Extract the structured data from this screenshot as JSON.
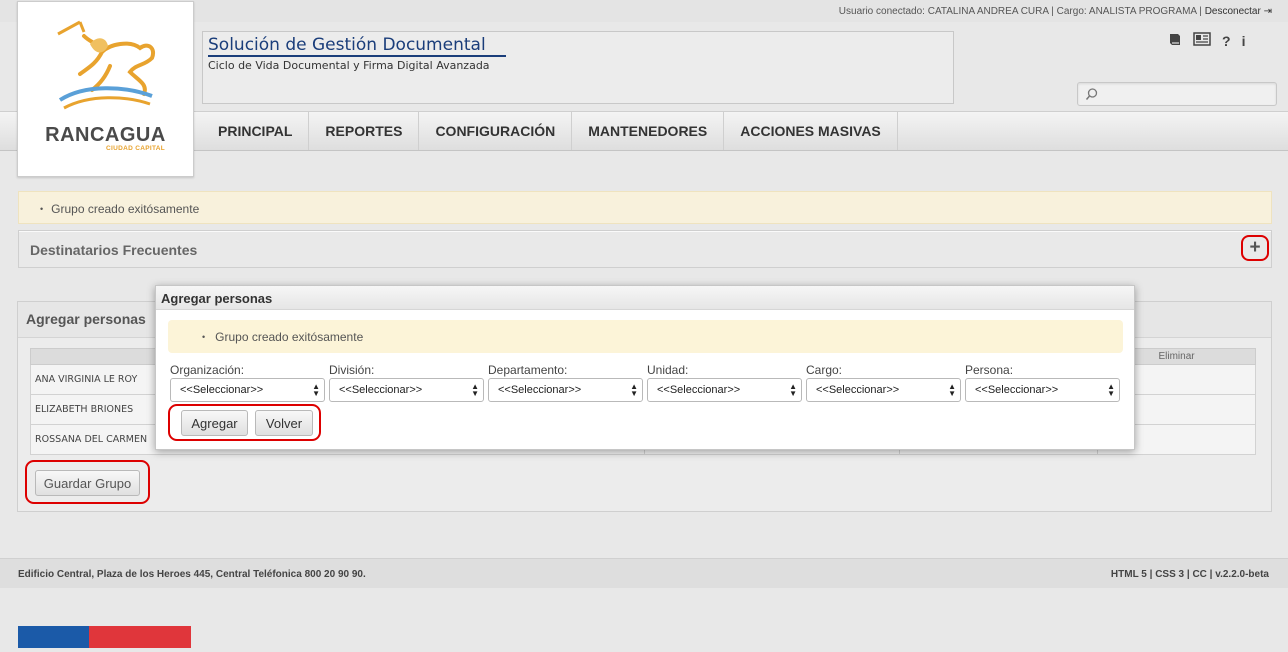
{
  "session": {
    "user_info": "Usuario conectado: CATALINA ANDREA CURA | Cargo: ANALISTA PROGRAMA |",
    "logout": "Desconectar"
  },
  "logo": {
    "city": "RANCAGUA",
    "subtitle": "CIUDAD CAPITAL"
  },
  "app": {
    "title": "Solución de Gestión Documental",
    "subtitle": "Ciclo de Vida Documental y Firma Digital Avanzada"
  },
  "header_icons": [
    "book-icon",
    "news-icon",
    "help-icon",
    "info-icon"
  ],
  "search": {
    "placeholder": ""
  },
  "nav": {
    "items": [
      "PRINCIPAL",
      "REPORTES",
      "CONFIGURACIÓN",
      "MANTENEDORES",
      "ACCIONES MASIVAS"
    ]
  },
  "alert": {
    "message": "Grupo creado exitósamente"
  },
  "destinatarios": {
    "title": "Destinatarios Frecuentes",
    "add_symbol": "+"
  },
  "panel": {
    "title": "Agregar personas",
    "table": {
      "header_last": "Eliminar",
      "rows": [
        "ANA VIRGINIA LE ROY",
        "ELIZABETH BRIONES",
        "ROSSANA DEL CARMEN"
      ]
    },
    "save_button": "Guardar Grupo"
  },
  "modal": {
    "title": "Agregar personas",
    "alert": "Grupo creado exitósamente",
    "fields": [
      {
        "label": "Organización:",
        "value": "<<Seleccionar>>"
      },
      {
        "label": "División:",
        "value": "<<Seleccionar>>"
      },
      {
        "label": "Departamento:",
        "value": "<<Seleccionar>>"
      },
      {
        "label": "Unidad:",
        "value": "<<Seleccionar>>"
      },
      {
        "label": "Cargo:",
        "value": "<<Seleccionar>>"
      },
      {
        "label": "Persona:",
        "value": "<<Seleccionar>>"
      }
    ],
    "add_button": "Agregar",
    "back_button": "Volver"
  },
  "footer": {
    "address": "Edificio Central, Plaza de los Heroes 445, Central Teléfonica 800 20 90 90.",
    "version": "HTML 5 | CSS 3 | CC | v.2.2.0-beta"
  },
  "colors": {
    "accent": "#1a3d7a",
    "highlight_ring": "#dd0000",
    "alert_bg": "#f8f1dc",
    "flag_blue": "#1b5aa8",
    "flag_red": "#e0363b"
  }
}
